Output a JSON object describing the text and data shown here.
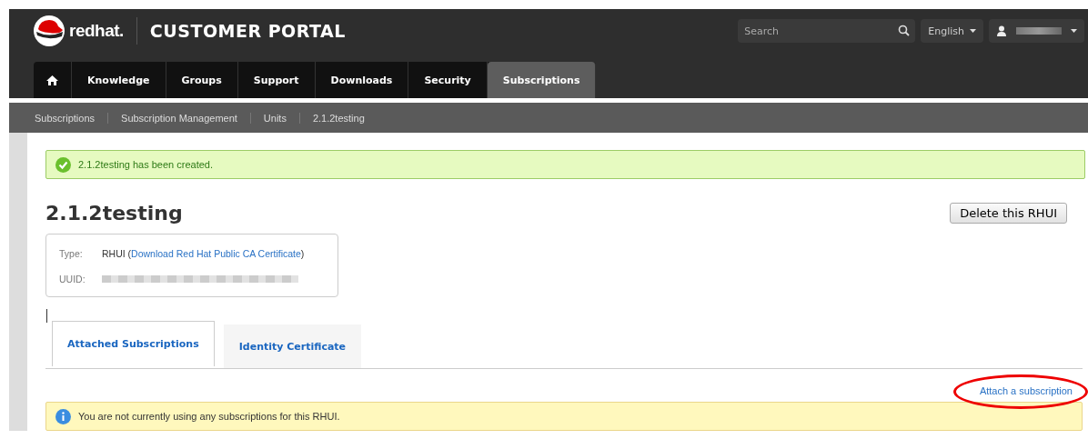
{
  "header": {
    "brand": "redhat.",
    "title": "CUSTOMER PORTAL",
    "search": {
      "placeholder": "Search"
    },
    "language": "English"
  },
  "nav": [
    {
      "label": "Knowledge",
      "selected": false
    },
    {
      "label": "Groups",
      "selected": false
    },
    {
      "label": "Support",
      "selected": false
    },
    {
      "label": "Downloads",
      "selected": false
    },
    {
      "label": "Security",
      "selected": false
    },
    {
      "label": "Subscriptions",
      "selected": true
    }
  ],
  "breadcrumbs": [
    "Subscriptions",
    "Subscription Management",
    "Units",
    "2.1.2testing"
  ],
  "success_alert": "2.1.2testing has been created.",
  "page_title": "2.1.2testing",
  "delete_button": "Delete this RHUI",
  "details": {
    "type_label": "Type:",
    "type_value": "RHUI (",
    "type_link": "Download Red Hat Public CA Certificate",
    "type_close": ")",
    "uuid_label": "UUID:"
  },
  "tabs": [
    {
      "label": "Attached Subscriptions",
      "selected": true
    },
    {
      "label": "Identity Certificate",
      "selected": false
    }
  ],
  "attach_link": "Attach a subscription",
  "info_alert": "You are not currently using any subscriptions for this RHUI."
}
